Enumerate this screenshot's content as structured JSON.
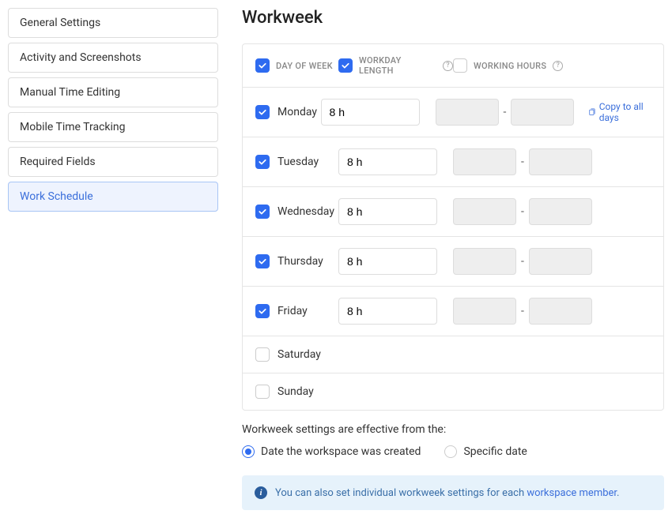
{
  "sidebar": {
    "items": [
      {
        "label": "General Settings",
        "active": false
      },
      {
        "label": "Activity and Screenshots",
        "active": false
      },
      {
        "label": "Manual Time Editing",
        "active": false
      },
      {
        "label": "Mobile Time Tracking",
        "active": false
      },
      {
        "label": "Required Fields",
        "active": false
      },
      {
        "label": "Work Schedule",
        "active": true
      }
    ]
  },
  "main": {
    "title": "Workweek",
    "columns": {
      "day": "DAY OF WEEK",
      "length": "WORKDAY LENGTH",
      "hours": "WORKING HOURS",
      "day_checked": true,
      "length_checked": true,
      "hours_checked": false
    },
    "copy_label": "Copy to all days",
    "days": [
      {
        "name": "Monday",
        "checked": true,
        "length": "8 h",
        "show_hours": true,
        "show_copy": true
      },
      {
        "name": "Tuesday",
        "checked": true,
        "length": "8 h",
        "show_hours": true,
        "show_copy": false
      },
      {
        "name": "Wednesday",
        "checked": true,
        "length": "8 h",
        "show_hours": true,
        "show_copy": false
      },
      {
        "name": "Thursday",
        "checked": true,
        "length": "8 h",
        "show_hours": true,
        "show_copy": false
      },
      {
        "name": "Friday",
        "checked": true,
        "length": "8 h",
        "show_hours": true,
        "show_copy": false
      },
      {
        "name": "Saturday",
        "checked": false,
        "length": "",
        "show_hours": false,
        "show_copy": false
      },
      {
        "name": "Sunday",
        "checked": false,
        "length": "",
        "show_hours": false,
        "show_copy": false
      }
    ],
    "effective_label": "Workweek settings are effective from the:",
    "radio_options": [
      {
        "label": "Date the workspace was created",
        "checked": true
      },
      {
        "label": "Specific date",
        "checked": false
      }
    ],
    "info_banner": {
      "text": "You can also set individual workweek settings for each ",
      "link": "workspace member",
      "suffix": "."
    }
  }
}
